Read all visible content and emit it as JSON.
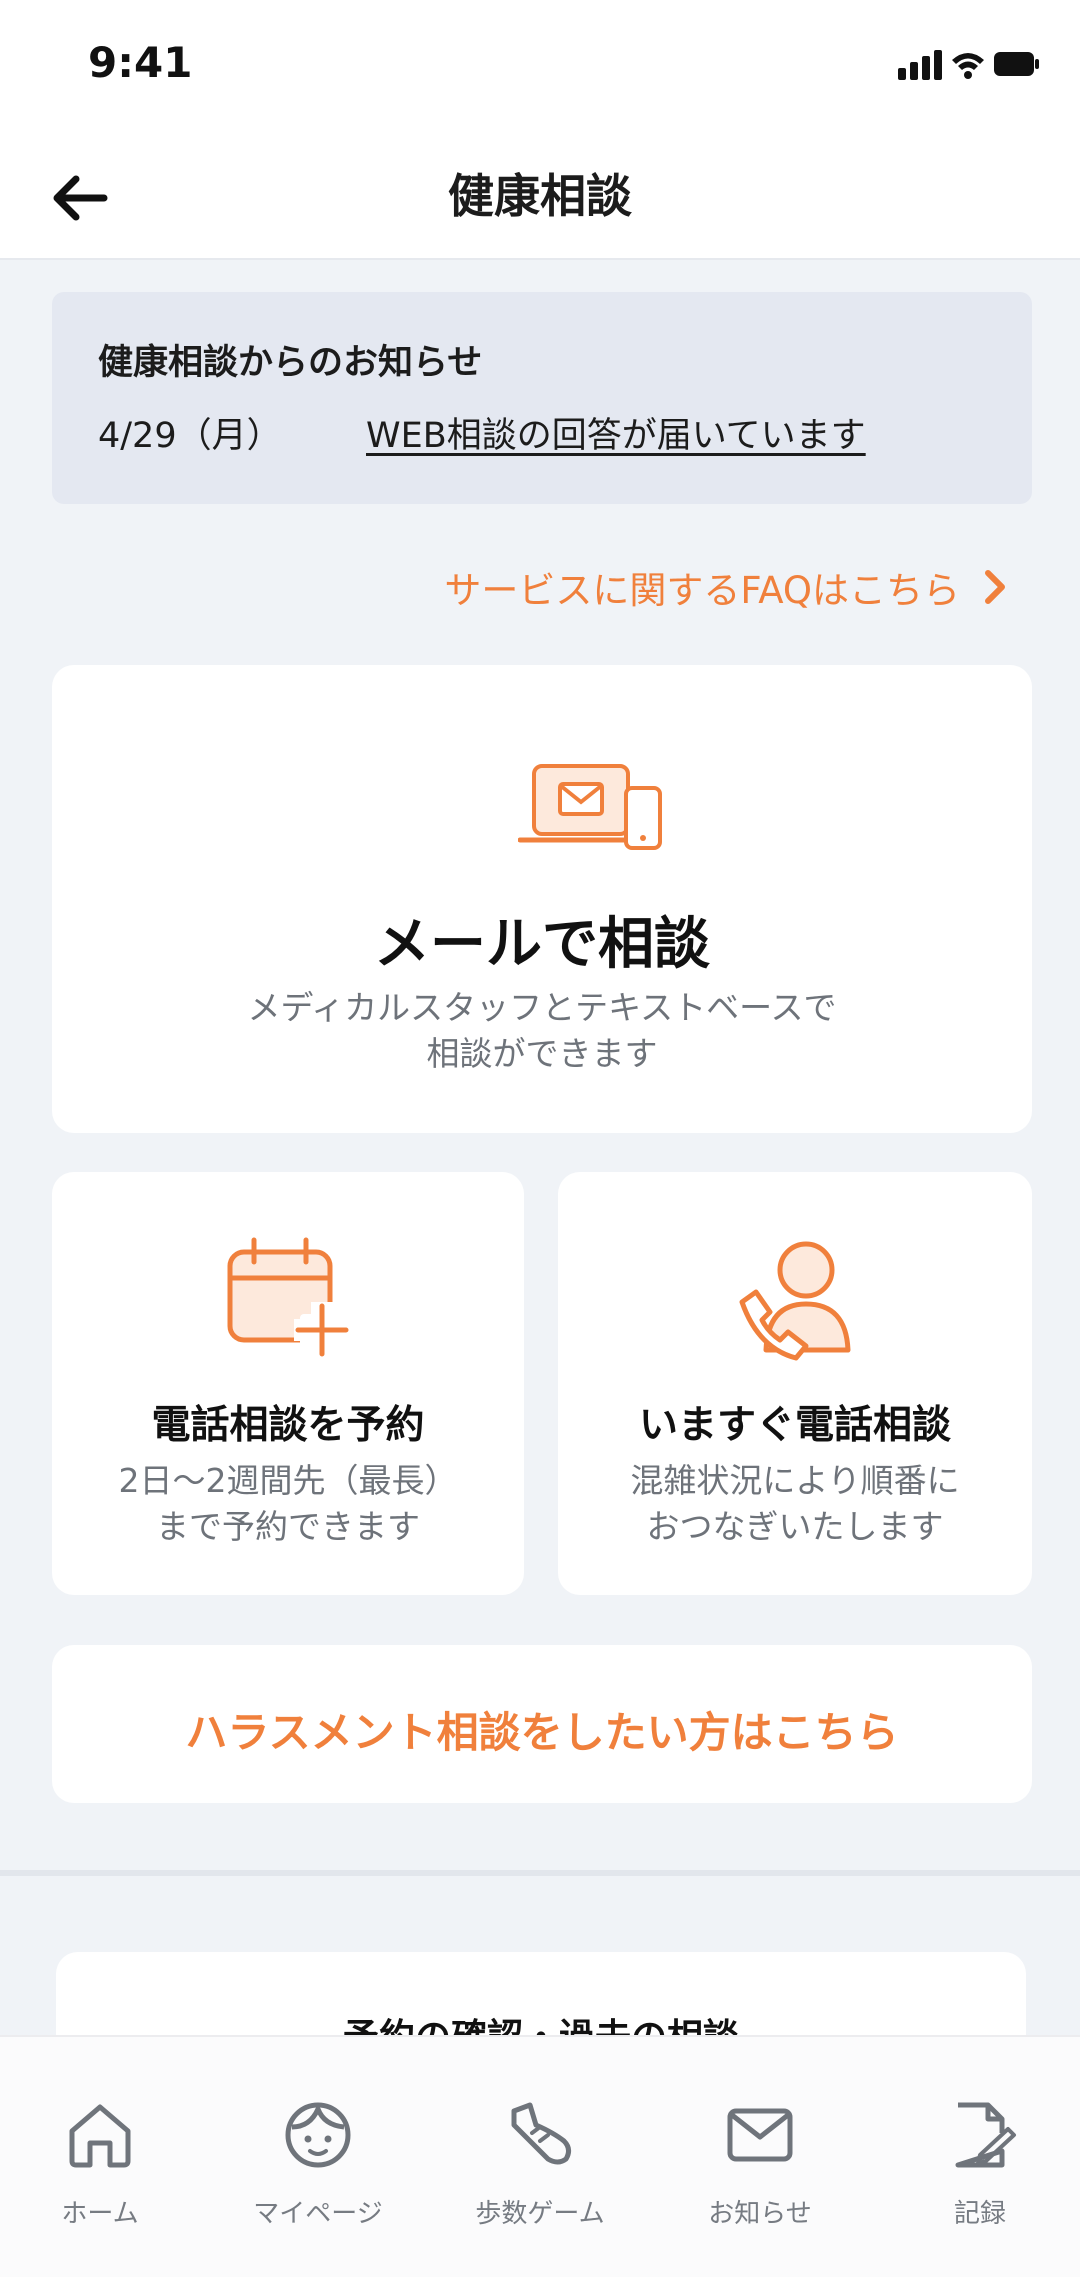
{
  "status_bar": {
    "time": "9:41"
  },
  "nav": {
    "title": "健康相談",
    "back_icon": "arrow-left-icon"
  },
  "notice": {
    "title": "健康相談からのお知らせ",
    "date": "4/29（月）",
    "link_text": "WEB相談の回答が届いています"
  },
  "faq": {
    "label": "サービスに関するFAQはこちら",
    "icon": "chevron-right-icon"
  },
  "mail_card": {
    "icon": "laptop-mail-icon",
    "title": "メールで相談",
    "desc_line1": "メディカルスタッフとテキストベースで",
    "desc_line2": "相談ができます"
  },
  "reserve_card": {
    "icon": "calendar-plus-icon",
    "title": "電話相談を予約",
    "desc_line1": "2日〜2週間先（最長）",
    "desc_line2": "まで予約できます"
  },
  "now_card": {
    "icon": "person-phone-icon",
    "title": "いますぐ電話相談",
    "desc_line1": "混雑状況により順番に",
    "desc_line2": "おつなぎいたします"
  },
  "harassment": {
    "label": "ハラスメント相談をしたい方はこちら"
  },
  "history": {
    "title": "予約の確認・過去の相談"
  },
  "tabbar": {
    "items": [
      {
        "label": "ホーム",
        "icon": "home-icon"
      },
      {
        "label": "マイページ",
        "icon": "face-icon"
      },
      {
        "label": "歩数ゲーム",
        "icon": "shoe-icon"
      },
      {
        "label": "お知らせ",
        "icon": "mail-icon"
      },
      {
        "label": "記録",
        "icon": "record-icon"
      }
    ]
  },
  "colors": {
    "accent": "#f0803c",
    "background": "#f0f3f7",
    "notice_bg": "#e4e8f1"
  }
}
